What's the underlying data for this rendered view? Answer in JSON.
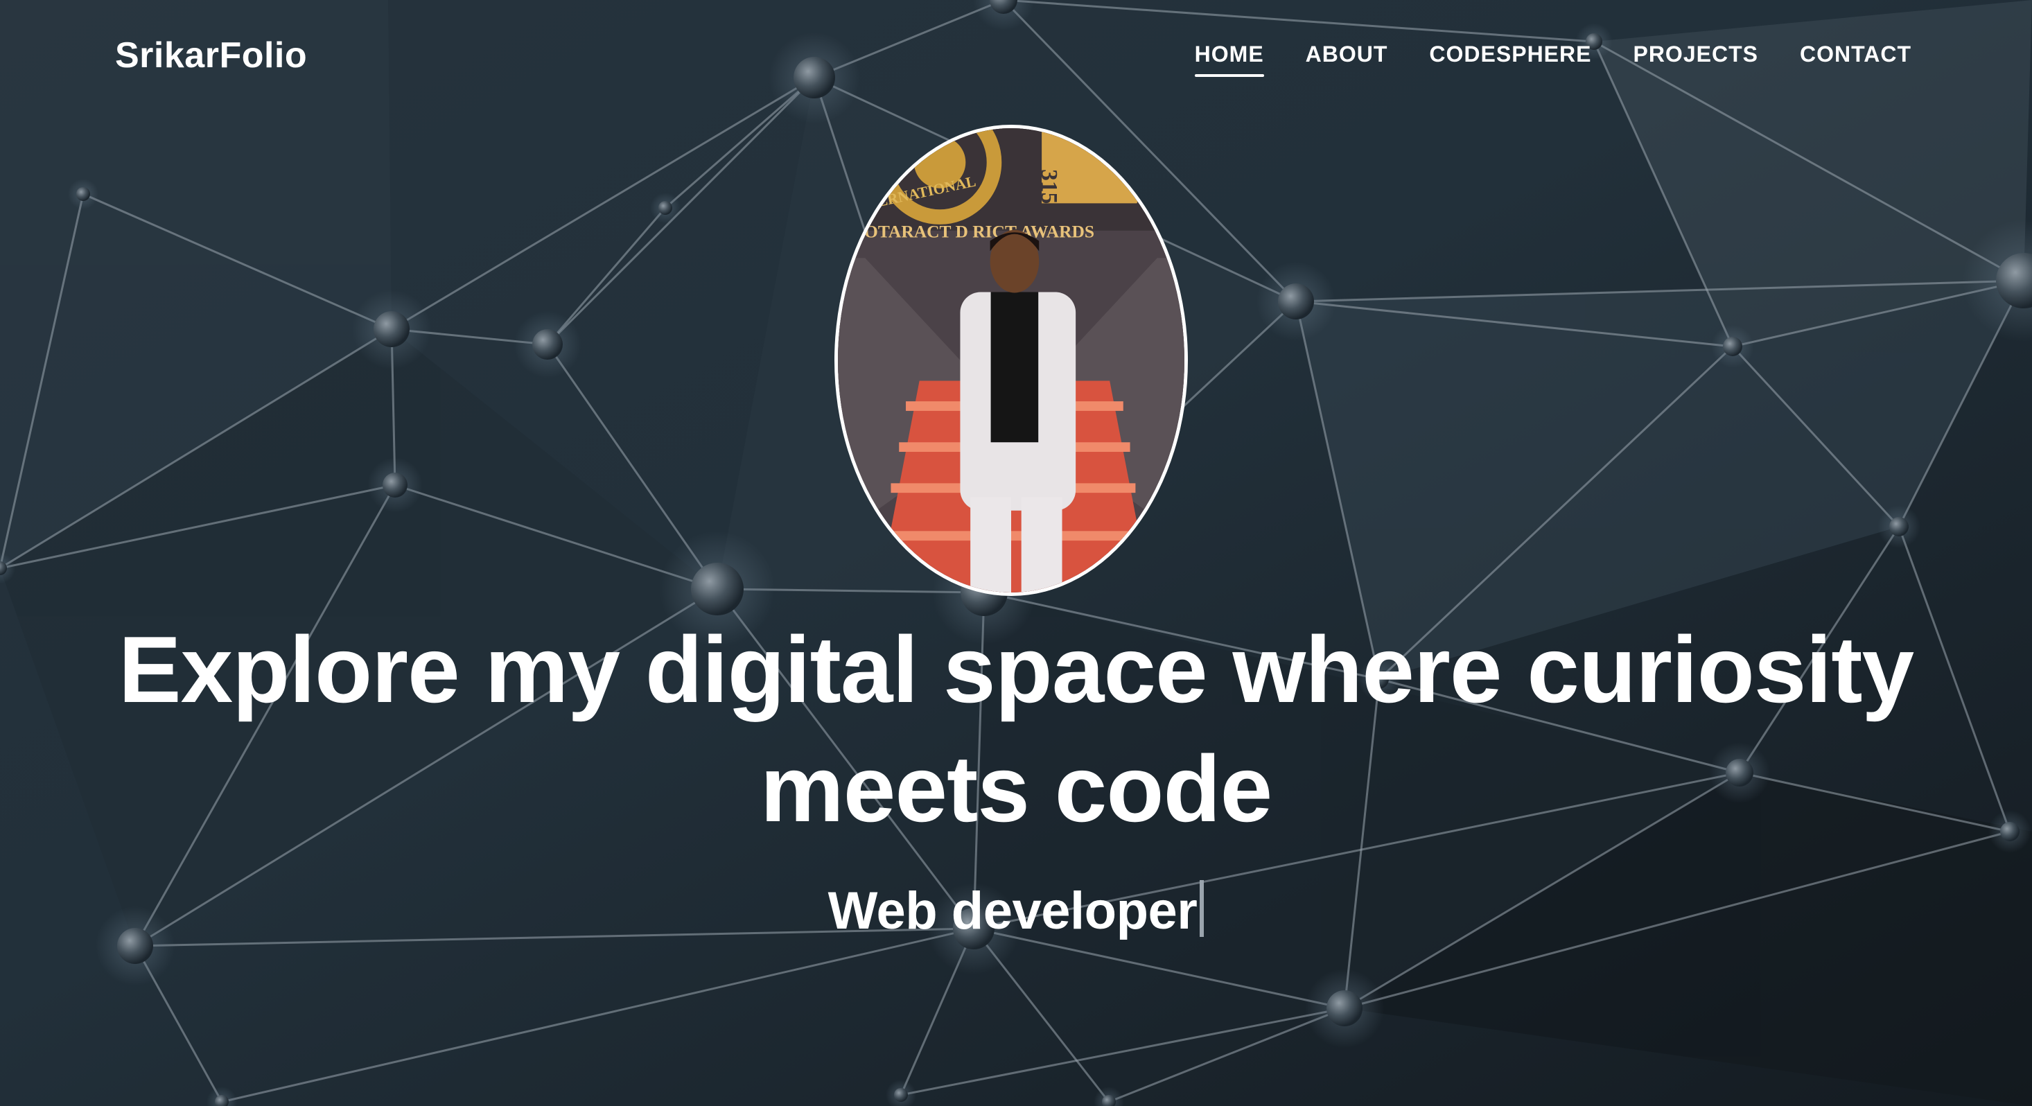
{
  "header": {
    "logo": "SrikarFolio",
    "nav": [
      {
        "label": "HOME",
        "active": true
      },
      {
        "label": "ABOUT",
        "active": false
      },
      {
        "label": "CODESPHERE",
        "active": false
      },
      {
        "label": "PROJECTS",
        "active": false
      },
      {
        "label": "CONTACT",
        "active": false
      }
    ]
  },
  "hero": {
    "headline": "Explore my digital space where curiosity meets code",
    "typed_text": "Web developer",
    "portrait": {
      "backdrop_text": "ROTARACT D  RICT AWARDS",
      "emblem_text": "ERNATIONAL",
      "number_text": "315"
    }
  },
  "colors": {
    "background": "#1c2831",
    "text": "#ffffff",
    "network_line": "#9aa6ae",
    "carpet": "#d8533f",
    "gold": "#c99a3a"
  },
  "icons": {
    "typing_cursor": "text-cursor-icon"
  }
}
